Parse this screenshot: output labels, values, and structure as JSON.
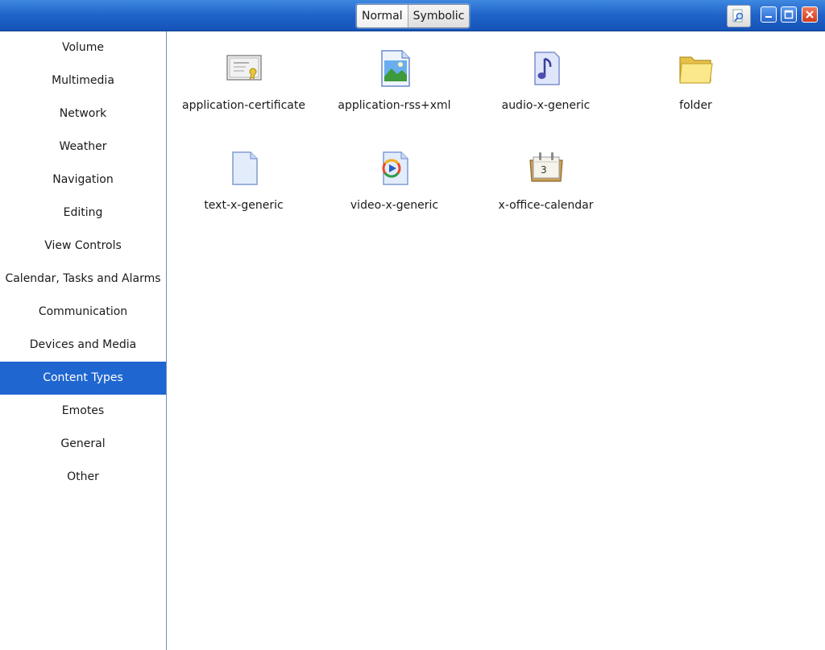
{
  "header": {
    "modes": [
      "Normal",
      "Symbolic"
    ],
    "active_mode": "Normal"
  },
  "sidebar": {
    "items": [
      {
        "label": "Volume"
      },
      {
        "label": "Multimedia"
      },
      {
        "label": "Network"
      },
      {
        "label": "Weather"
      },
      {
        "label": "Navigation"
      },
      {
        "label": "Editing"
      },
      {
        "label": "View Controls"
      },
      {
        "label": "Calendar, Tasks and Alarms"
      },
      {
        "label": "Communication"
      },
      {
        "label": "Devices and Media"
      },
      {
        "label": "Content Types"
      },
      {
        "label": "Emotes"
      },
      {
        "label": "General"
      },
      {
        "label": "Other"
      }
    ],
    "selected": "Content Types"
  },
  "icons": [
    {
      "label": "application-certificate",
      "icon": "certificate-icon"
    },
    {
      "label": "application-rss+xml",
      "icon": "image-document-icon"
    },
    {
      "label": "audio-x-generic",
      "icon": "music-note-icon"
    },
    {
      "label": "folder",
      "icon": "folder-icon"
    },
    {
      "label": "text-x-generic",
      "icon": "text-document-icon"
    },
    {
      "label": "video-x-generic",
      "icon": "video-document-icon"
    },
    {
      "label": "x-office-calendar",
      "icon": "calendar-icon"
    }
  ],
  "colors": {
    "accent": "#1f66d0",
    "header": "#1f63c8",
    "close": "#d23a1c"
  }
}
